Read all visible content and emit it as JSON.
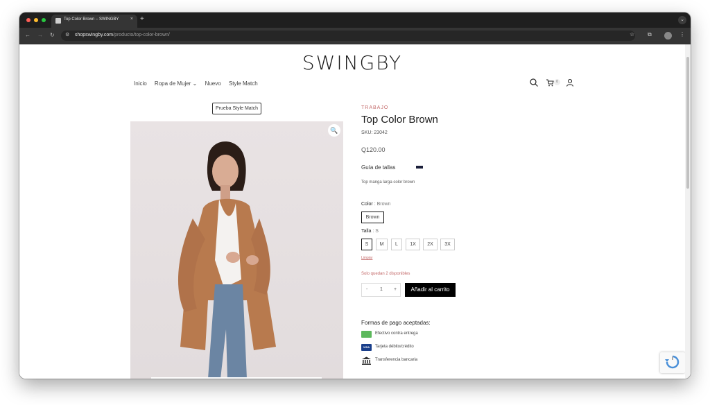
{
  "browser": {
    "tab_title": "Top Color Brown – SWINGBY",
    "tab_close": "×",
    "new_tab": "+",
    "url_host": "shopswingby.com",
    "url_path": "/producto/top-color-brown/"
  },
  "site": {
    "logo": "SWINGBY",
    "nav": [
      "Inicio",
      "Ropa de Mujer",
      "Nuevo",
      "Style Match"
    ],
    "cart_count": "0"
  },
  "product": {
    "try_button": "Prueba Style Match",
    "category": "TRABAJO",
    "title": "Top Color Brown",
    "sku": "SKU: 23042",
    "price": "Q120.00",
    "size_guide": "Guía de tallas",
    "description": "Top manga larga color brown",
    "color_label": "Color",
    "color_value": ": Brown",
    "color_options": [
      "Brown"
    ],
    "size_label": "Talla",
    "size_value": ": S",
    "size_options": [
      "S",
      "M",
      "L",
      "1X",
      "2X",
      "3X"
    ],
    "selected_size": "S",
    "clear": "Limpiar",
    "stock": "Solo quedan 2 disponibles",
    "qty_minus": "-",
    "qty_value": "1",
    "qty_plus": "+",
    "add_to_cart": "Añadir al carrito"
  },
  "payment": {
    "title": "Formas de pago aceptadas:",
    "methods": [
      {
        "label": "Efectivo contra entrega",
        "icon": "cash-icon",
        "color": "#5cb85c"
      },
      {
        "label": "Tarjeta débito/crédito",
        "icon": "visa-card-icon",
        "color": "#1a3f8b"
      },
      {
        "label": "Transferencia bancaria",
        "icon": "bank-icon",
        "color": "#333333"
      }
    ]
  },
  "colors": {
    "accent": "#c46b6b",
    "button": "#000000"
  }
}
